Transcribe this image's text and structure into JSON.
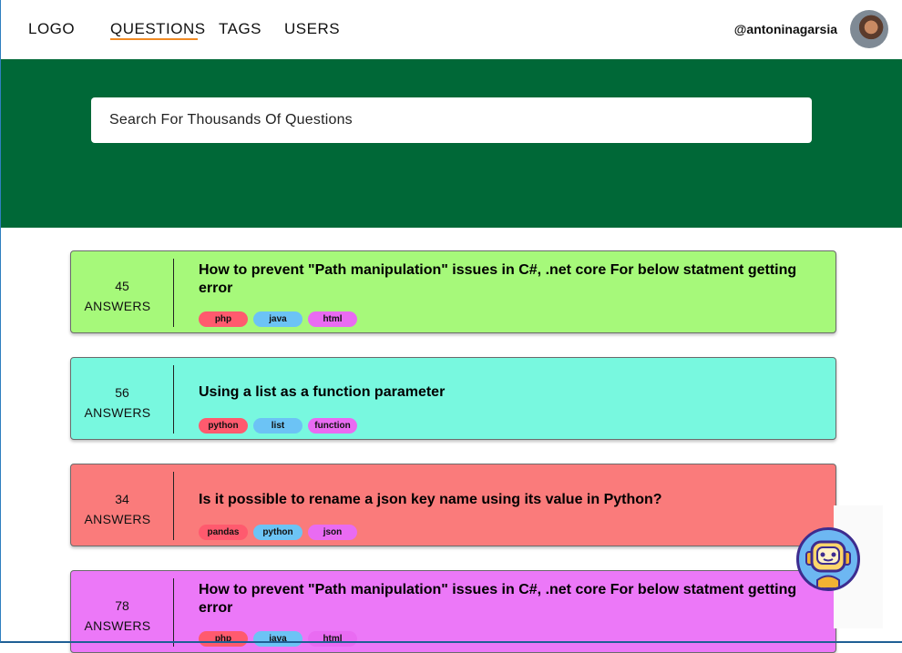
{
  "nav": {
    "logo": "LOGO",
    "links": [
      {
        "label": "QUESTIONS",
        "active": true
      },
      {
        "label": "TAGS",
        "active": false
      },
      {
        "label": "USERS",
        "active": false
      }
    ],
    "username": "@antoninagarsia",
    "accent_color": "#f08a24"
  },
  "search": {
    "placeholder": "Search For Thousands Of Questions"
  },
  "hero_color": "#006837",
  "questions": [
    {
      "count": "45",
      "count_label": "ANSWERS",
      "title": "How to prevent \"Path manipulation\" issues in C#, .net core For below statment getting error",
      "tags": [
        "php",
        "java",
        "html"
      ],
      "color": "#a6f97a"
    },
    {
      "count": "56",
      "count_label": "ANSWERS",
      "title": "Using a list as a function parameter",
      "tags": [
        "python",
        "list",
        "function"
      ],
      "color": "#78f8df"
    },
    {
      "count": "34",
      "count_label": "ANSWERS",
      "title": "Is it possible to rename a json key name using its value in Python?",
      "tags": [
        "pandas",
        "python",
        "json"
      ],
      "color": "#fa7b7b"
    },
    {
      "count": "78",
      "count_label": "ANSWERS",
      "title": "How to prevent \"Path manipulation\" issues in C#, .net core For below statment getting error",
      "tags": [
        "php",
        "java",
        "html"
      ],
      "color": "#ec78f8"
    }
  ],
  "chat_bot": {
    "icon": "robot-icon"
  }
}
